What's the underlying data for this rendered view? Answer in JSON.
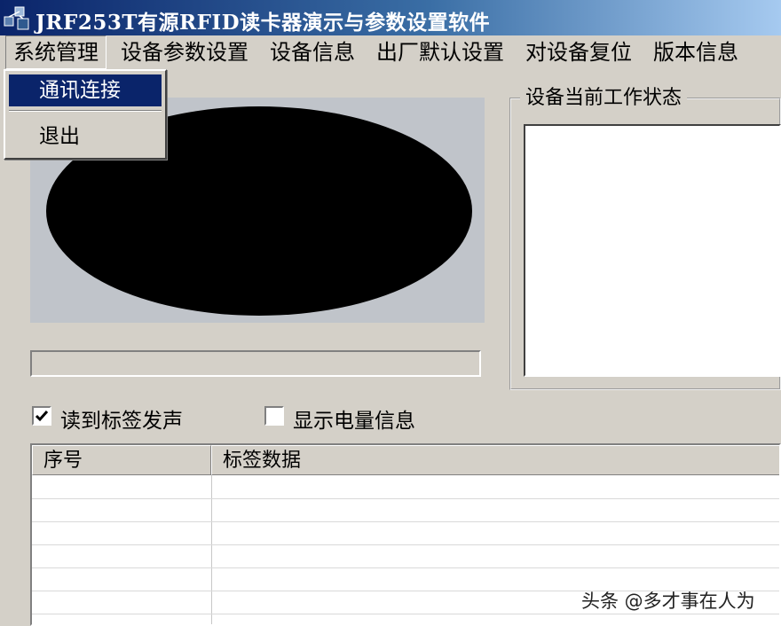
{
  "window": {
    "title": "JRF253T有源RFID读卡器演示与参数设置软件"
  },
  "menu": [
    "系统管理",
    "设备参数设置",
    "设备信息",
    "出厂默认设置",
    "对设备复位",
    "版本信息"
  ],
  "dropdown": {
    "items": [
      "通讯连接",
      "退出"
    ],
    "highlighted": "通讯连接"
  },
  "status_group": {
    "title": "设备当前工作状态"
  },
  "options": {
    "beep_on_read": {
      "label": "读到标签发声",
      "checked": true
    },
    "show_battery": {
      "label": "显示电量信息",
      "checked": false
    }
  },
  "table": {
    "columns": [
      "序号",
      "标签数据"
    ]
  },
  "watermark": "头条 @多才事在人为",
  "colors": {
    "title_bar": "#0a246a",
    "face": "#d4d0c8",
    "highlight": "#0a246a",
    "indicator": "#000000"
  }
}
